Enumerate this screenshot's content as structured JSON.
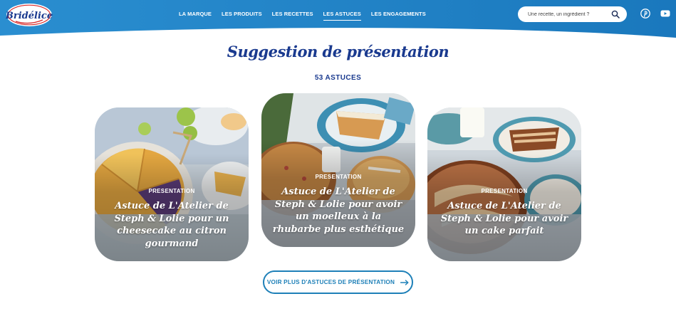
{
  "header": {
    "logo_text": "Bridélice",
    "nav": [
      {
        "label": "LA MARQUE",
        "active": false
      },
      {
        "label": "LES PRODUITS",
        "active": false
      },
      {
        "label": "LES RECETTES",
        "active": false
      },
      {
        "label": "LES ASTUCES",
        "active": true
      },
      {
        "label": "LES ENGAGEMENTS",
        "active": false
      }
    ],
    "search": {
      "placeholder": "Une recette, un ingrédient ?",
      "value": "",
      "icon": "search-icon"
    },
    "social": [
      {
        "icon": "pinterest-icon"
      },
      {
        "icon": "youtube-icon"
      }
    ]
  },
  "section": {
    "title": "Suggestion de présentation",
    "count": "53 ASTUCES"
  },
  "cards": [
    {
      "category": "PRESENTATION",
      "title": "Astuce de L'Atelier de Steph & Lolie pour un cheesecake au citron gourmand"
    },
    {
      "category": "PRESENTATION",
      "title": "Astuce de L'Atelier de Steph & Lolie pour avoir un moelleux à la rhubarbe plus esthétique"
    },
    {
      "category": "PRESENTATION",
      "title": "Astuce de L'Atelier de Steph & Lolie pour avoir un cake parfait"
    }
  ],
  "more_button": {
    "label": "VOIR PLUS D'ASTUCES DE PRÉSENTATION",
    "icon": "arrow-right-icon"
  },
  "colors": {
    "header_blue": "#1e80c2",
    "title_navy": "#1a3a8f",
    "button_blue": "#1e80b8"
  }
}
